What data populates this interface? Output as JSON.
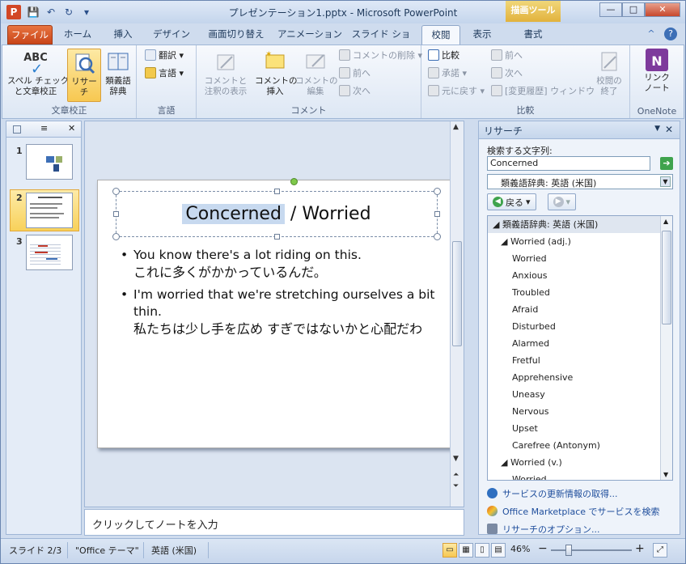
{
  "window": {
    "title": "プレゼンテーション1.pptx - Microsoft PowerPoint",
    "context_tab": "描画ツール",
    "buttons": {
      "minimize": "—",
      "maximize": "□",
      "close": "✕"
    }
  },
  "qat": {
    "save": "💾",
    "undo": "↶",
    "redo": "↻",
    "more": "▾"
  },
  "tabs": [
    "ファイル",
    "ホーム",
    "挿入",
    "デザイン",
    "画面切り替え",
    "アニメーション",
    "スライド ショー",
    "校閲",
    "表示",
    "書式"
  ],
  "active_tab": "校閲",
  "ribbon": {
    "proofing": {
      "label": "文章校正",
      "spell": "スペル チェック\nと文章校正",
      "spell_icon_text": "ABC",
      "research": "リサーチ",
      "thesaurus": "類義語\n辞典"
    },
    "language": {
      "label": "言語",
      "translate": "翻訳",
      "language": "言語"
    },
    "comments": {
      "label": "コメント",
      "show_markup": "コメントと\n注釈の表示",
      "new_comment": "コメントの\n挿入",
      "edit_comment": "コメントの\n編集",
      "delete": "コメントの削除",
      "previous": "前へ",
      "next": "次へ"
    },
    "compare": {
      "label": "比較",
      "compare": "比較",
      "accept": "承諾",
      "reject": "元に戻す",
      "previous": "前へ",
      "next": "次へ",
      "reviewing_pane": "[変更履歴] ウィンドウ",
      "end_review": "校閲の\n終了"
    },
    "onenote": {
      "label": "OneNote",
      "linked_notes": "リンク\nノート"
    }
  },
  "slides_panel": {
    "thumbnails": [
      "1",
      "2",
      "3"
    ],
    "selected": "2"
  },
  "slide": {
    "title_highlight": "Concerned",
    "title_rest": " / Worried",
    "bullets": [
      {
        "en": "You know there's a lot riding on this.",
        "jp": "これに多くがかかっているんだ。"
      },
      {
        "en": "I'm worried that we're stretching ourselves a bit thin.",
        "jp": "私たちは少し手を広め すぎではないかと心配だわ"
      }
    ]
  },
  "notes_placeholder": "クリックしてノートを入力",
  "research": {
    "title": "リサーチ",
    "search_label": "検索する文字列:",
    "search_value": "Concerned",
    "source": "類義語辞典: 英語 (米国)",
    "back": "戻る",
    "results": [
      {
        "kind": "sec",
        "text": "◢ 類義語辞典: 英語 (米国)"
      },
      {
        "kind": "sub",
        "text": "◢ Worried (adj.)"
      },
      {
        "kind": "item",
        "text": "Worried"
      },
      {
        "kind": "item",
        "text": "Anxious"
      },
      {
        "kind": "item",
        "text": "Troubled"
      },
      {
        "kind": "item",
        "text": "Afraid"
      },
      {
        "kind": "item",
        "text": "Disturbed"
      },
      {
        "kind": "item",
        "text": "Alarmed"
      },
      {
        "kind": "item",
        "text": "Fretful"
      },
      {
        "kind": "item",
        "text": "Apprehensive"
      },
      {
        "kind": "item",
        "text": "Uneasy"
      },
      {
        "kind": "item",
        "text": "Nervous"
      },
      {
        "kind": "item",
        "text": "Upset"
      },
      {
        "kind": "item",
        "text": "Carefree (Antonym)"
      },
      {
        "kind": "sub",
        "text": "◢ Worried (v.)"
      },
      {
        "kind": "item",
        "text": "Worried"
      }
    ],
    "links": {
      "updates": "サービスの更新情報の取得...",
      "marketplace": "Office Marketplace でサービスを検索",
      "options": "リサーチのオプション..."
    }
  },
  "status": {
    "slide": "スライド 2/3",
    "theme": "\"Office テーマ\"",
    "language": "英語 (米国)",
    "zoom": "46%",
    "zoom_minus": "−",
    "zoom_plus": "+"
  }
}
